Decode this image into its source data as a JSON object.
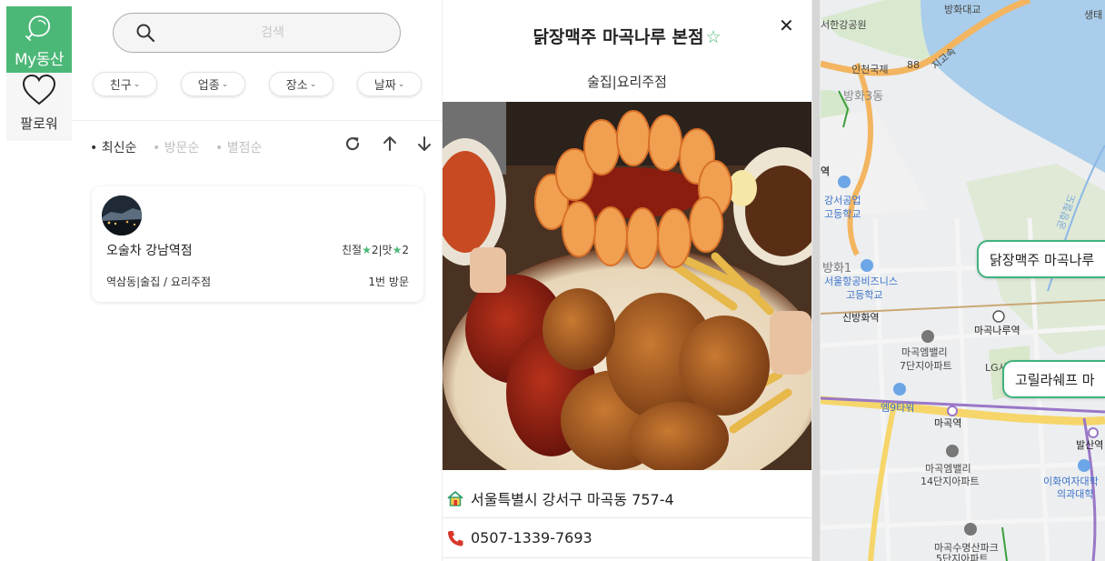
{
  "nav": {
    "my_area_label": "My동산",
    "follow_label": "팔로워"
  },
  "search": {
    "placeholder": "검색"
  },
  "filters": [
    {
      "label": "친구"
    },
    {
      "label": "업종"
    },
    {
      "label": "장소"
    },
    {
      "label": "날짜"
    }
  ],
  "sort": {
    "options": [
      {
        "label": "최신순",
        "active": true
      },
      {
        "label": "방문순",
        "active": false
      },
      {
        "label": "별점순",
        "active": false
      }
    ]
  },
  "card": {
    "name": "오술차 강남역점",
    "rating_kind": "친절",
    "rating_kind_value": "2",
    "rating_taste": "맛",
    "rating_taste_value": "2",
    "category": "역삼동|술집 / 요리주점",
    "visits": "1번 방문"
  },
  "detail": {
    "title": "닭장맥주 마곡나루 본점",
    "category": "술집|요리주점",
    "address": "서울특별시 강서구 마곡동 757-4",
    "phone": "0507-1339-7693"
  },
  "map": {
    "labels": {
      "l1": "방화대교",
      "l2": "생태",
      "l3": "서한강공원",
      "l4": "인천국제",
      "l5": "88",
      "l6": "방화3동",
      "l7": "강서공업",
      "l8": "고등학교",
      "l9": "방화1",
      "l10": "서울항공비즈니스",
      "l11": "고등학교",
      "l12": "신방화역",
      "l13": "마곡나루역",
      "l14": "마곡엠밸리",
      "l15": "7단지아파트",
      "l16": "LG사",
      "l17": "마곡역",
      "l18": "발산역",
      "l19": "마곡엠밸리",
      "l20": "14단지아파트",
      "l21": "이화여자대학",
      "l22": "의과대학",
      "l23": "마곡수명산파크",
      "l24": "5단지아파트",
      "l25": "역",
      "l26": "엠9타워",
      "l27": "지고속",
      "l28": "공항철도"
    },
    "bubbles": [
      {
        "label": "닭장맥주 마곡나루"
      },
      {
        "label": "고릴라쉐프 마"
      }
    ]
  },
  "colors": {
    "brand": "#4cb878",
    "bubble_border": "#3fb27d",
    "phone_icon": "#d9372b"
  }
}
